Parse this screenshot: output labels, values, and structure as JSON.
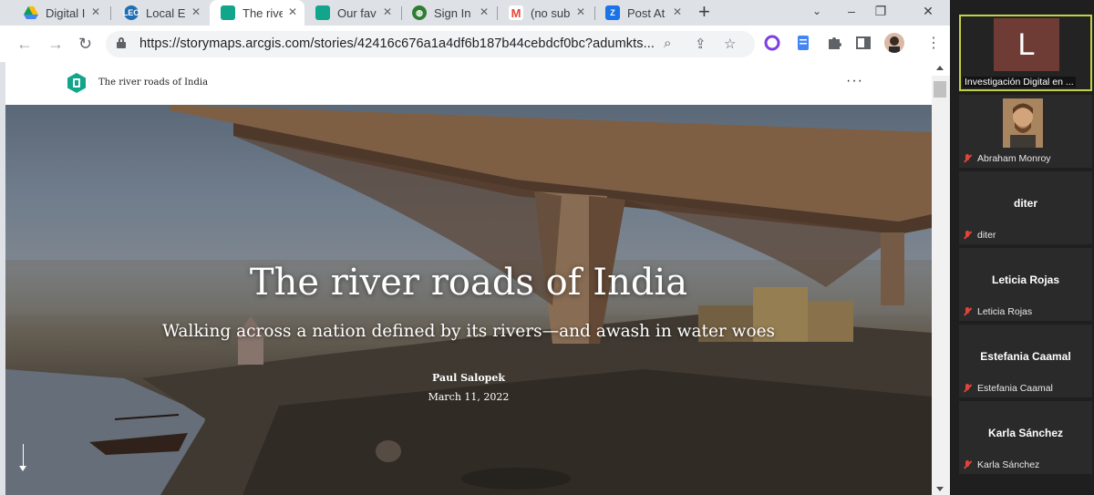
{
  "browser": {
    "tabs": [
      {
        "title": "Digital I",
        "icon": "google-drive-icon",
        "color": "#fbbc04"
      },
      {
        "title": "Local Er",
        "icon": "leo-icon",
        "color": "#1f6fb5"
      },
      {
        "title": "The rive",
        "icon": "storymaps-icon",
        "color": "#11a58c",
        "active": true
      },
      {
        "title": "Our fav",
        "icon": "storymaps-icon",
        "color": "#11a58c"
      },
      {
        "title": "Sign In",
        "icon": "globe-icon",
        "color": "#2e7d32"
      },
      {
        "title": "(no sub",
        "icon": "gmail-icon",
        "color": "#ea4335"
      },
      {
        "title": "Post At",
        "icon": "zoho-icon",
        "color": "#1a73e8"
      }
    ],
    "url": "https://storymaps.arcgis.com/stories/42416c676a1a4df6b187b44cebdcf0bc?adumkts..."
  },
  "story": {
    "header_title": "The river roads of India",
    "title": "The river roads of India",
    "subtitle": "Walking across a nation defined by its rivers—and awash in water woes",
    "author": "Paul Salopek",
    "date": "March 11, 2022"
  },
  "meeting": {
    "participants": [
      {
        "name": "Investigación Digital en ...",
        "avatar_letter": "L",
        "type": "letter",
        "active": true
      },
      {
        "name": "Abraham Monroy",
        "type": "photo",
        "muted": true
      },
      {
        "name": "diter",
        "type": "name",
        "muted": true
      },
      {
        "name": "Leticia Rojas",
        "type": "name",
        "muted": true
      },
      {
        "name": "Estefania Caamal",
        "type": "name",
        "muted": true
      },
      {
        "name": "Karla Sánchez",
        "type": "name",
        "muted": true
      }
    ]
  }
}
